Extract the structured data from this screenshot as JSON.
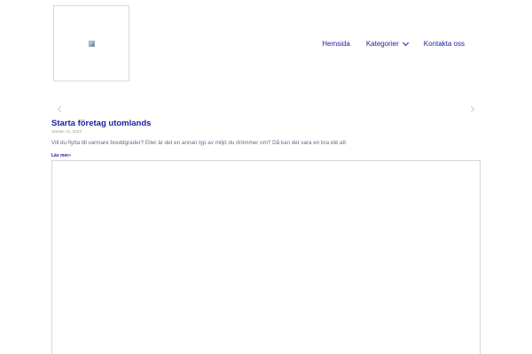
{
  "header": {
    "nav": [
      {
        "label": "Hemsida"
      },
      {
        "label": "Kategorier",
        "has_dropdown": true
      },
      {
        "label": "Kontakta oss"
      }
    ]
  },
  "post": {
    "title": "Starta företag utomlands",
    "date": "oktober 21, 2023",
    "excerpt": "Vill du flytta till varmare breddgrader? Eller är det en annan typ av miljö du drömmer om? Då kan det vara en bra idé att",
    "read_more": "Läs mer»"
  },
  "colors": {
    "accent": "#1b1ba3",
    "muted_text": "#666a8a",
    "border": "#d6d6d6"
  },
  "icons": {
    "logo": "broken-image-icon",
    "dropdown": "chevron-down-icon",
    "prev": "chevron-left-icon",
    "next": "chevron-right-icon"
  }
}
